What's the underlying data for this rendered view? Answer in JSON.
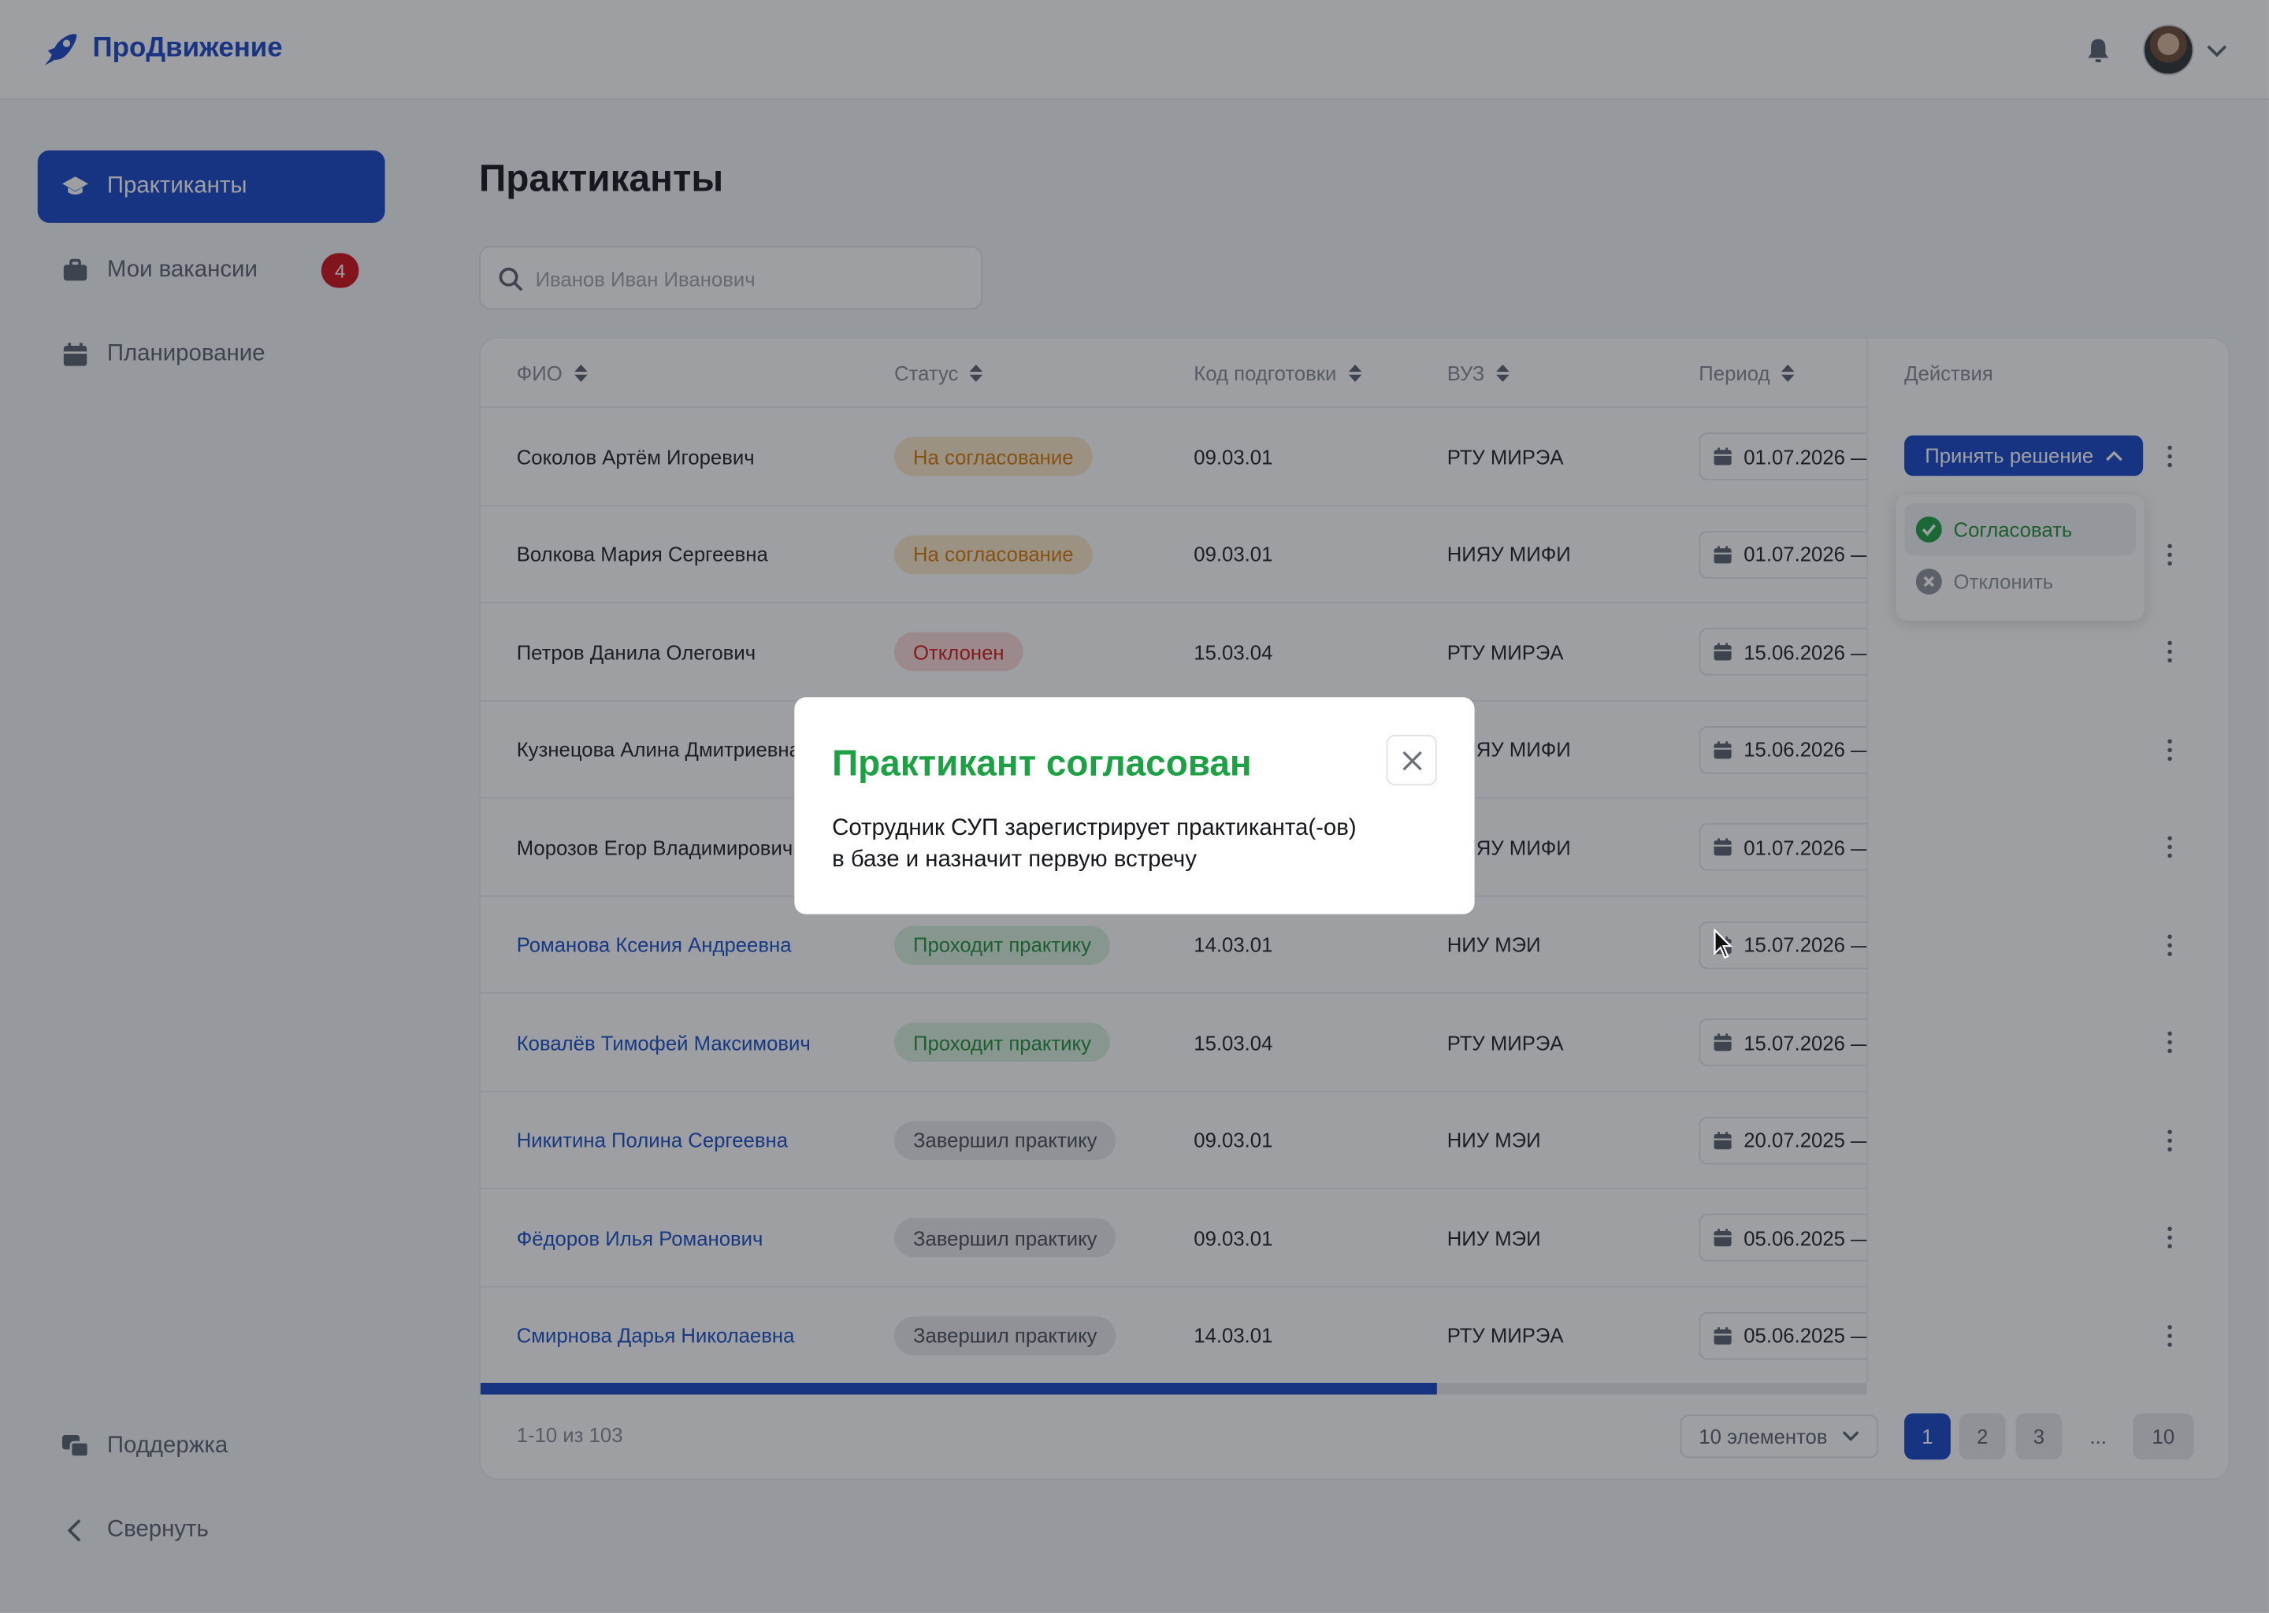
{
  "app": {
    "name": "ПроДвижение"
  },
  "header": {
    "notifications_icon": "bell-icon",
    "avatar_alt": "user-avatar"
  },
  "sidebar": {
    "items": [
      {
        "label": "Практиканты",
        "icon": "graduation-cap-icon",
        "active": true
      },
      {
        "label": "Мои вакансии",
        "icon": "briefcase-icon",
        "badge": "4"
      },
      {
        "label": "Планирование",
        "icon": "calendar-icon"
      }
    ],
    "support_label": "Поддержка",
    "collapse_label": "Свернуть"
  },
  "page": {
    "title": "Практиканты"
  },
  "search": {
    "placeholder": "Иванов Иван Иванович"
  },
  "table": {
    "headers": {
      "name": "ФИО",
      "status": "Статус",
      "code": "Код подготовки",
      "university": "ВУЗ",
      "period": "Период",
      "actions": "Действия"
    },
    "rows": [
      {
        "name": "Соколов Артём Игоревич",
        "status": "На согласование",
        "code": "09.03.01",
        "university": "РТУ МИРЭА",
        "period": "01.07.2026 —"
      },
      {
        "name": "Волкова Мария Сергеевна",
        "status": "На согласование",
        "code": "09.03.01",
        "university": "НИЯУ МИФИ",
        "period": "01.07.2026 —"
      },
      {
        "name": "Петров Данила Олегович",
        "status": "Отклонен",
        "code": "15.03.04",
        "university": "РТУ МИРЭА",
        "period": "15.06.2026 —"
      },
      {
        "name": "Кузнецова Алина Дмитриевна",
        "status": "",
        "code": "",
        "university": "НИЯУ МИФИ",
        "period": "15.06.2026 —"
      },
      {
        "name": "Морозов Егор Владимирович",
        "status": "",
        "code": "",
        "university": "НИЯУ МИФИ",
        "period": "01.07.2026 —"
      },
      {
        "name": "Романова Ксения Андреевна",
        "status": "Проходит практику",
        "code": "14.03.01",
        "university": "НИУ МЭИ",
        "period": "15.07.2026 —"
      },
      {
        "name": "Ковалёв Тимофей Максимович",
        "status": "Проходит практику",
        "code": "15.03.04",
        "university": "РТУ МИРЭА",
        "period": "15.07.2026 —"
      },
      {
        "name": "Никитина Полина Сергеевна",
        "status": "Завершил практику",
        "code": "09.03.01",
        "university": "НИУ МЭИ",
        "period": "20.07.2025 —"
      },
      {
        "name": "Фёдоров Илья Романович",
        "status": "Завершил практику",
        "code": "09.03.01",
        "university": "НИУ МЭИ",
        "period": "05.06.2025 —"
      },
      {
        "name": "Смирнова Дарья Николаевна",
        "status": "Завершил практику",
        "code": "14.03.01",
        "university": "РТУ МИРЭА",
        "period": "05.06.2025 —"
      }
    ],
    "decide_button": "Принять решение",
    "dropdown": {
      "approve": "Согласовать",
      "reject": "Отклонить"
    },
    "scroll_progress": 0.69
  },
  "footer": {
    "count": "1-10 из 103",
    "per_page": "10 элементов",
    "pages": [
      "1",
      "2",
      "3",
      "...",
      "10"
    ],
    "current_page": "1"
  },
  "modal": {
    "title": "Практикант согласован",
    "text_line1": "Сотрудник СУП зарегистрирует практиканта(-ов)",
    "text_line2": "в базе и назначит первую встречу"
  },
  "colors": {
    "primary": "#1848c9",
    "success": "#1ea144",
    "danger": "#d31b1b",
    "warning": "#d47a08"
  }
}
